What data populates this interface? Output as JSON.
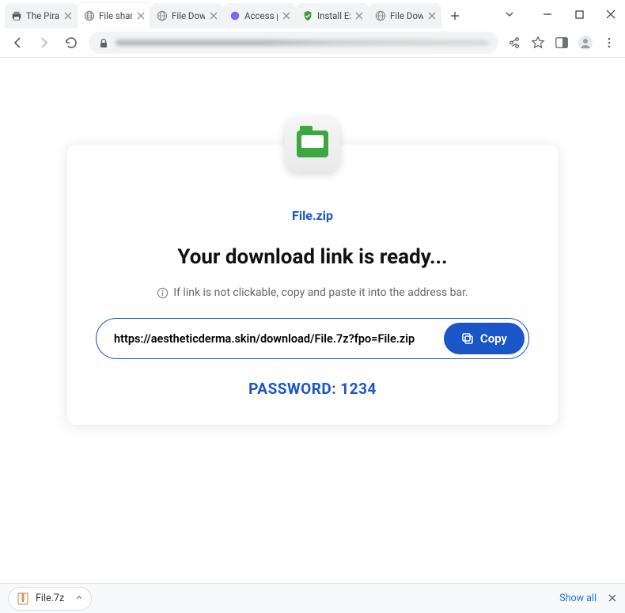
{
  "tabs": [
    {
      "title": "The Pirate",
      "favicon_type": "printer"
    },
    {
      "title": "File shari",
      "favicon_type": "globe",
      "active": true
    },
    {
      "title": "File Down",
      "favicon_type": "globe"
    },
    {
      "title": "Access po",
      "favicon_type": "purple"
    },
    {
      "title": "Install Ext",
      "favicon_type": "shield"
    },
    {
      "title": "File Down",
      "favicon_type": "globe"
    }
  ],
  "page": {
    "filename": "File.zip",
    "headline": "Your download link is ready...",
    "hint": "If link is not clickable, copy and paste it into the address bar.",
    "download_url": "https://aestheticderma.skin/download/File.7z?fpo=File.zip",
    "copy_label": "Copy",
    "password_label": "PASSWORD: 1234"
  },
  "download_shelf": {
    "filename": "File.7z",
    "show_all": "Show all"
  }
}
